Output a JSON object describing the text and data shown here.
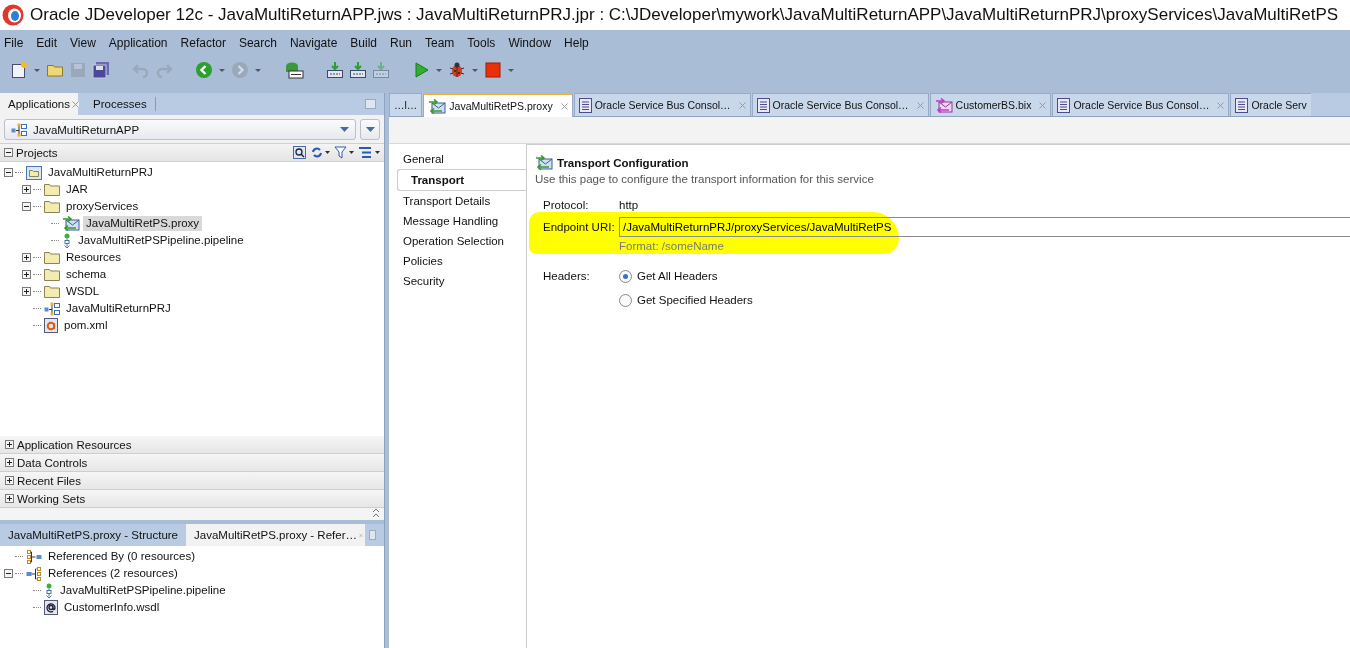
{
  "window": {
    "title": "Oracle JDeveloper 12c - JavaMultiReturnAPP.jws : JavaMultiReturnPRJ.jpr : C:\\JDeveloper\\mywork\\JavaMultiReturnAPP\\JavaMultiReturnPRJ\\proxyServices\\JavaMultiRetPS"
  },
  "menu": [
    "File",
    "Edit",
    "View",
    "Application",
    "Refactor",
    "Search",
    "Navigate",
    "Build",
    "Run",
    "Team",
    "Tools",
    "Window",
    "Help"
  ],
  "toolbar": [
    {
      "kind": "new",
      "disabled": false
    },
    {
      "kind": "caret",
      "disabled": false
    },
    {
      "kind": "open",
      "disabled": false
    },
    {
      "kind": "save",
      "disabled": true
    },
    {
      "kind": "save-all",
      "disabled": false
    },
    {
      "kind": "sep"
    },
    {
      "kind": "undo",
      "disabled": true
    },
    {
      "kind": "redo",
      "disabled": true
    },
    {
      "kind": "sep"
    },
    {
      "kind": "back",
      "disabled": false
    },
    {
      "kind": "caret",
      "disabled": false
    },
    {
      "kind": "forward",
      "disabled": true
    },
    {
      "kind": "caret",
      "disabled": false
    },
    {
      "kind": "sep"
    },
    {
      "kind": "sql",
      "disabled": false
    },
    {
      "kind": "sep"
    },
    {
      "kind": "deploy",
      "disabled": false
    },
    {
      "kind": "deploy",
      "disabled": false
    },
    {
      "kind": "deploy",
      "disabled": true
    },
    {
      "kind": "sep"
    },
    {
      "kind": "run",
      "disabled": false
    },
    {
      "kind": "caret",
      "disabled": false
    },
    {
      "kind": "debug",
      "disabled": false
    },
    {
      "kind": "caret",
      "disabled": false
    },
    {
      "kind": "stop",
      "disabled": false
    },
    {
      "kind": "caret",
      "disabled": false
    }
  ],
  "applications_panel": {
    "tabs": [
      {
        "label": "Applications",
        "selected": true
      },
      {
        "label": "Processes",
        "selected": false
      }
    ],
    "application_selector": {
      "value": "JavaMultiReturnAPP"
    },
    "projects_header": {
      "label": "Projects",
      "expanded": true
    },
    "tree": [
      {
        "label": "JavaMultiReturnPRJ",
        "kind": "project",
        "expanded": true,
        "selected": false,
        "children": [
          {
            "label": "JAR",
            "kind": "folder",
            "expanded": false,
            "selected": false
          },
          {
            "label": "proxyServices",
            "kind": "folder",
            "expanded": true,
            "selected": false,
            "children": [
              {
                "label": "JavaMultiRetPS.proxy",
                "kind": "proxy",
                "selected": true
              },
              {
                "label": "JavaMultiRetPSPipeline.pipeline",
                "kind": "pipeline",
                "selected": false
              }
            ]
          },
          {
            "label": "Resources",
            "kind": "folder",
            "expanded": false,
            "selected": false
          },
          {
            "label": "schema",
            "kind": "folder",
            "expanded": false,
            "selected": false
          },
          {
            "label": "WSDL",
            "kind": "folder",
            "expanded": false,
            "selected": false
          },
          {
            "label": "JavaMultiReturnPRJ",
            "kind": "jpr",
            "selected": false
          },
          {
            "label": "pom.xml",
            "kind": "maven",
            "selected": false
          }
        ]
      }
    ],
    "sections": [
      {
        "label": "Application Resources",
        "expanded": false
      },
      {
        "label": "Data Controls",
        "expanded": false
      },
      {
        "label": "Recent Files",
        "expanded": false
      },
      {
        "label": "Working Sets",
        "expanded": false
      }
    ]
  },
  "references_panel": {
    "tabs": [
      {
        "label": "JavaMultiRetPS.proxy - Structure",
        "selected": false
      },
      {
        "label": "JavaMultiRetPS.proxy - Refer…",
        "selected": true
      }
    ],
    "tree": [
      {
        "label": "Referenced By (0 resources)",
        "kind": "refby",
        "selected": false
      },
      {
        "label": "References (2 resources)",
        "kind": "refs",
        "expanded": true,
        "selected": false,
        "children": [
          {
            "label": "JavaMultiRetPSPipeline.pipeline",
            "kind": "pipeline",
            "selected": false
          },
          {
            "label": "CustomerInfo.wsdl",
            "kind": "wsdl",
            "selected": false
          }
        ]
      }
    ]
  },
  "editor_tabs": [
    {
      "label": "…l…",
      "kind": "overflow",
      "selected": false
    },
    {
      "label": "JavaMultiRetPS.proxy",
      "kind": "proxy",
      "selected": true
    },
    {
      "label": "Oracle Service Bus Consol…",
      "kind": "page",
      "selected": false
    },
    {
      "label": "Oracle Service Bus Consol…",
      "kind": "page",
      "selected": false
    },
    {
      "label": "CustomerBS.bix",
      "kind": "bix",
      "selected": false
    },
    {
      "label": "Oracle Service Bus Consol…",
      "kind": "page",
      "selected": false
    },
    {
      "label": "Oracle Serv",
      "kind": "page",
      "selected": false
    }
  ],
  "editor_nav": [
    {
      "label": "General",
      "selected": false
    },
    {
      "label": "Transport",
      "selected": true
    },
    {
      "label": "Transport Details",
      "selected": false
    },
    {
      "label": "Message Handling",
      "selected": false
    },
    {
      "label": "Operation Selection",
      "selected": false
    },
    {
      "label": "Policies",
      "selected": false
    },
    {
      "label": "Security",
      "selected": false
    }
  ],
  "transport": {
    "title": "Transport Configuration",
    "description": "Use this page to configure the transport information for this service",
    "protocol_label": "Protocol:",
    "protocol": "http",
    "endpoint_label": "Endpoint URI:",
    "endpoint_value": "/JavaMultiReturnPRJ/proxyServices/JavaMultiRetPS",
    "format_hint": "Format: /someName",
    "headers_label": "Headers:",
    "headers_options": [
      {
        "label": "Get All Headers",
        "selected": true
      },
      {
        "label": "Get Specified Headers",
        "selected": false
      }
    ]
  }
}
